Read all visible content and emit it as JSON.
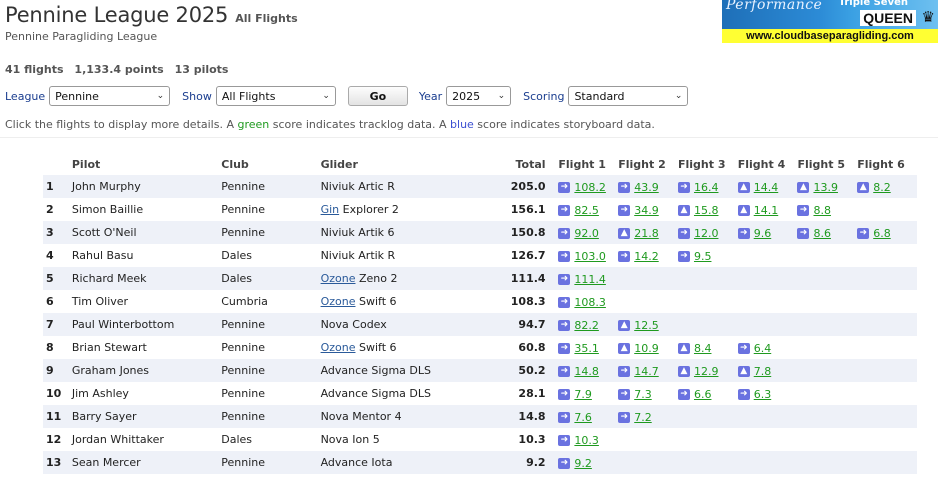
{
  "header": {
    "title": "Pennine League 2025",
    "subtitle": "All Flights",
    "league_name": "Pennine Paragliding League"
  },
  "banner": {
    "performance_text": "Performance",
    "triple_text": "Triple Seven",
    "brand_text": "QUEEN",
    "url_text": "www.cloudbaseparagliding.com"
  },
  "stats": {
    "flights": "41 flights",
    "points": "1,133.4 points",
    "pilots": "13 pilots"
  },
  "filters": {
    "league_label": "League",
    "league_value": "Pennine",
    "show_label": "Show",
    "show_value": "All Flights",
    "go_label": "Go",
    "year_label": "Year",
    "year_value": "2025",
    "scoring_label": "Scoring",
    "scoring_value": "Standard"
  },
  "hint": {
    "part1": "Click the flights to display more details. A ",
    "green_word": "green",
    "part2": " score indicates tracklog data. A ",
    "blue_word": "blue",
    "part3": " score indicates storyboard data."
  },
  "colors": {
    "tracklog_green": "#1f9a1f",
    "storyboard_blue": "#3b4fd1",
    "icon_blue": "#6a72e0",
    "row_stripe": "#eef1f8"
  },
  "table": {
    "columns": [
      "",
      "Pilot",
      "Club",
      "Glider",
      "Total",
      "Flight 1",
      "Flight 2",
      "Flight 3",
      "Flight 4",
      "Flight 5",
      "Flight 6"
    ],
    "rows": [
      {
        "rank": "1",
        "pilot": "John Murphy",
        "club": "Pennine",
        "glider_brand": "",
        "glider": "Niviuk Artic R",
        "total": "205.0",
        "flights": [
          {
            "icon": "route-arrow-icon",
            "score": "108.2"
          },
          {
            "icon": "route-arrow-icon",
            "score": "43.9"
          },
          {
            "icon": "route-arrow-icon",
            "score": "16.4"
          },
          {
            "icon": "triangle-icon",
            "score": "14.4"
          },
          {
            "icon": "triangle-icon",
            "score": "13.9"
          },
          {
            "icon": "triangle-icon",
            "score": "8.2"
          }
        ]
      },
      {
        "rank": "2",
        "pilot": "Simon Baillie",
        "club": "Pennine",
        "glider_brand": "Gin",
        "glider": " Explorer 2",
        "total": "156.1",
        "flights": [
          {
            "icon": "route-arrow-icon",
            "score": "82.5"
          },
          {
            "icon": "route-arrow-icon",
            "score": "34.9"
          },
          {
            "icon": "triangle-icon",
            "score": "15.8"
          },
          {
            "icon": "triangle-icon",
            "score": "14.1"
          },
          {
            "icon": "route-arrow-icon",
            "score": "8.8"
          }
        ]
      },
      {
        "rank": "3",
        "pilot": "Scott O'Neil",
        "club": "Pennine",
        "glider_brand": "",
        "glider": "Niviuk Artik 6",
        "total": "150.8",
        "flights": [
          {
            "icon": "route-arrow-icon",
            "score": "92.0"
          },
          {
            "icon": "triangle-icon",
            "score": "21.8"
          },
          {
            "icon": "route-arrow-icon",
            "score": "12.0"
          },
          {
            "icon": "route-arrow-icon",
            "score": "9.6"
          },
          {
            "icon": "route-arrow-icon",
            "score": "8.6"
          },
          {
            "icon": "route-arrow-icon",
            "score": "6.8"
          }
        ]
      },
      {
        "rank": "4",
        "pilot": "Rahul Basu",
        "club": "Dales",
        "glider_brand": "",
        "glider": "Niviuk Artik R",
        "total": "126.7",
        "flights": [
          {
            "icon": "route-arrow-icon",
            "score": "103.0"
          },
          {
            "icon": "route-arrow-icon",
            "score": "14.2"
          },
          {
            "icon": "route-arrow-icon",
            "score": "9.5"
          }
        ]
      },
      {
        "rank": "5",
        "pilot": "Richard Meek",
        "club": "Dales",
        "glider_brand": "Ozone",
        "glider": " Zeno 2",
        "total": "111.4",
        "flights": [
          {
            "icon": "route-arrow-icon",
            "score": "111.4"
          }
        ]
      },
      {
        "rank": "6",
        "pilot": "Tim Oliver",
        "club": "Cumbria",
        "glider_brand": "Ozone",
        "glider": " Swift 6",
        "total": "108.3",
        "flights": [
          {
            "icon": "route-arrow-icon",
            "score": "108.3"
          }
        ]
      },
      {
        "rank": "7",
        "pilot": "Paul Winterbottom",
        "club": "Pennine",
        "glider_brand": "",
        "glider": "Nova Codex",
        "total": "94.7",
        "flights": [
          {
            "icon": "route-arrow-icon",
            "score": "82.2"
          },
          {
            "icon": "triangle-icon",
            "score": "12.5"
          }
        ]
      },
      {
        "rank": "8",
        "pilot": "Brian Stewart",
        "club": "Pennine",
        "glider_brand": "Ozone",
        "glider": " Swift 6",
        "total": "60.8",
        "flights": [
          {
            "icon": "route-arrow-icon",
            "score": "35.1"
          },
          {
            "icon": "triangle-icon",
            "score": "10.9"
          },
          {
            "icon": "triangle-icon",
            "score": "8.4"
          },
          {
            "icon": "route-arrow-icon",
            "score": "6.4"
          }
        ]
      },
      {
        "rank": "9",
        "pilot": "Graham Jones",
        "club": "Pennine",
        "glider_brand": "",
        "glider": "Advance Sigma DLS",
        "total": "50.2",
        "flights": [
          {
            "icon": "route-arrow-icon",
            "score": "14.8"
          },
          {
            "icon": "route-arrow-icon",
            "score": "14.7"
          },
          {
            "icon": "triangle-icon",
            "score": "12.9"
          },
          {
            "icon": "triangle-icon",
            "score": "7.8"
          }
        ]
      },
      {
        "rank": "10",
        "pilot": "Jim Ashley",
        "club": "Pennine",
        "glider_brand": "",
        "glider": "Advance Sigma DLS",
        "total": "28.1",
        "flights": [
          {
            "icon": "route-arrow-icon",
            "score": "7.9"
          },
          {
            "icon": "route-arrow-icon",
            "score": "7.3"
          },
          {
            "icon": "route-arrow-icon",
            "score": "6.6"
          },
          {
            "icon": "route-arrow-icon",
            "score": "6.3"
          }
        ]
      },
      {
        "rank": "11",
        "pilot": "Barry Sayer",
        "club": "Pennine",
        "glider_brand": "",
        "glider": "Nova Mentor 4",
        "total": "14.8",
        "flights": [
          {
            "icon": "route-arrow-icon",
            "score": "7.6"
          },
          {
            "icon": "route-arrow-icon",
            "score": "7.2"
          }
        ]
      },
      {
        "rank": "12",
        "pilot": "Jordan Whittaker",
        "club": "Dales",
        "glider_brand": "",
        "glider": "Nova Ion 5",
        "total": "10.3",
        "flights": [
          {
            "icon": "route-arrow-icon",
            "score": "10.3"
          }
        ]
      },
      {
        "rank": "13",
        "pilot": "Sean Mercer",
        "club": "Pennine",
        "glider_brand": "",
        "glider": "Advance Iota",
        "total": "9.2",
        "flights": [
          {
            "icon": "route-arrow-icon",
            "score": "9.2"
          }
        ]
      }
    ]
  }
}
